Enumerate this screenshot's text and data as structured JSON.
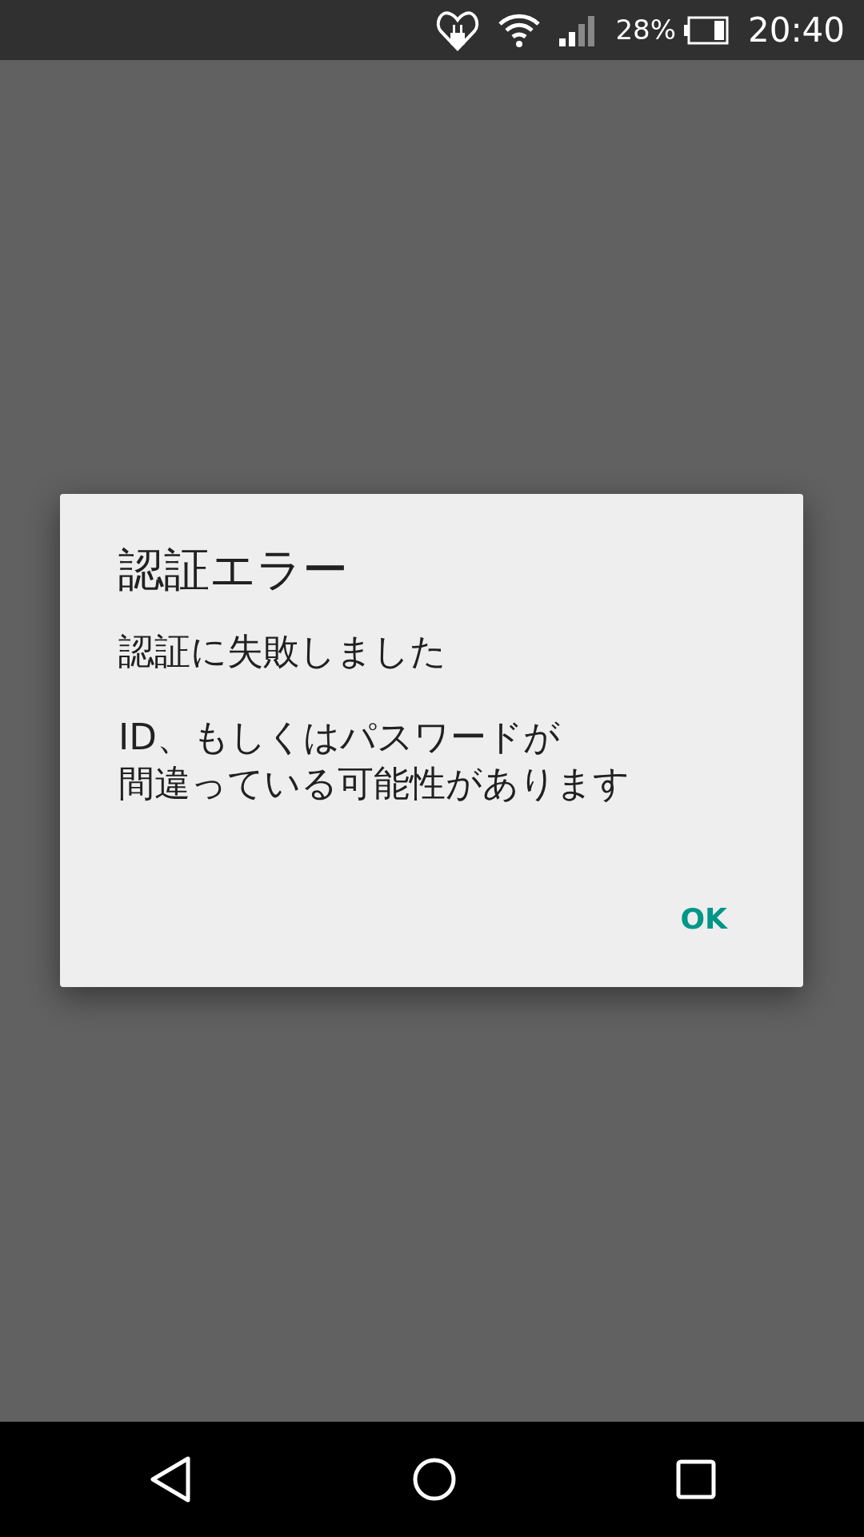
{
  "status_bar": {
    "battery_percent": "28%",
    "time": "20:40"
  },
  "dialog": {
    "title": "認証エラー",
    "message": [
      [
        "認証に失敗しました"
      ],
      [
        "ID、もしくはパスワードが",
        "間違っている可能性があります"
      ]
    ],
    "buttons": [
      "OK"
    ]
  }
}
